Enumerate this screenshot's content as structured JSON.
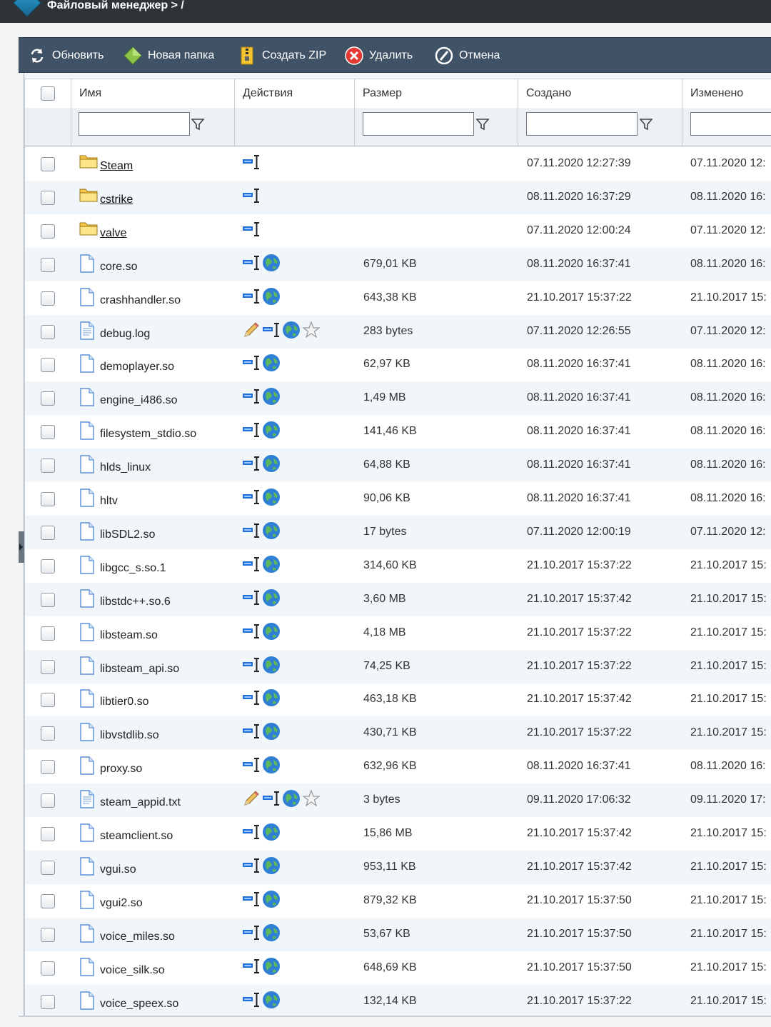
{
  "window": {
    "title": "Файловый менеджер > /"
  },
  "toolbar": {
    "refresh_label": "Обновить",
    "new_folder_label": "Новая папка",
    "create_zip_label": "Создать ZIP",
    "delete_label": "Удалить",
    "cancel_label": "Отмена"
  },
  "columns": {
    "name": "Имя",
    "actions": "Действия",
    "size": "Размер",
    "created": "Создано",
    "modified": "Изменено"
  },
  "filters": {
    "name": "",
    "size": "",
    "created": "",
    "modified": ""
  },
  "colors": {
    "toolbar": "#3f5266",
    "titlebar": "#2e3338",
    "row_alt": "#f1f6fb"
  },
  "files": [
    {
      "name": "Steam",
      "type": "folder",
      "actions": [
        "rename-icon"
      ],
      "size": "",
      "created": "07.11.2020 12:27:39",
      "modified": "07.11.2020 12:"
    },
    {
      "name": "cstrike",
      "type": "folder",
      "actions": [
        "rename-icon"
      ],
      "size": "",
      "created": "08.11.2020 16:37:29",
      "modified": "08.11.2020 16:"
    },
    {
      "name": "valve",
      "type": "folder",
      "actions": [
        "rename-icon"
      ],
      "size": "",
      "created": "07.11.2020 12:00:24",
      "modified": "07.11.2020 12:"
    },
    {
      "name": "core.so",
      "type": "file",
      "actions": [
        "rename-icon",
        "web-icon"
      ],
      "size": "679,01 KB",
      "created": "08.11.2020 16:37:41",
      "modified": "08.11.2020 16:"
    },
    {
      "name": "crashhandler.so",
      "type": "file",
      "actions": [
        "rename-icon",
        "web-icon"
      ],
      "size": "643,38 KB",
      "created": "21.10.2017 15:37:22",
      "modified": "21.10.2017 15:"
    },
    {
      "name": "debug.log",
      "type": "text",
      "actions": [
        "edit-icon",
        "rename-icon",
        "web-icon",
        "star-icon"
      ],
      "size": "283 bytes",
      "created": "07.11.2020 12:26:55",
      "modified": "07.11.2020 12:"
    },
    {
      "name": "demoplayer.so",
      "type": "file",
      "actions": [
        "rename-icon",
        "web-icon"
      ],
      "size": "62,97 KB",
      "created": "08.11.2020 16:37:41",
      "modified": "08.11.2020 16:"
    },
    {
      "name": "engine_i486.so",
      "type": "file",
      "actions": [
        "rename-icon",
        "web-icon"
      ],
      "size": "1,49 MB",
      "created": "08.11.2020 16:37:41",
      "modified": "08.11.2020 16:"
    },
    {
      "name": "filesystem_stdio.so",
      "type": "file",
      "actions": [
        "rename-icon",
        "web-icon"
      ],
      "size": "141,46 KB",
      "created": "08.11.2020 16:37:41",
      "modified": "08.11.2020 16:"
    },
    {
      "name": "hlds_linux",
      "type": "file",
      "actions": [
        "rename-icon",
        "web-icon"
      ],
      "size": "64,88 KB",
      "created": "08.11.2020 16:37:41",
      "modified": "08.11.2020 16:"
    },
    {
      "name": "hltv",
      "type": "file",
      "actions": [
        "rename-icon",
        "web-icon"
      ],
      "size": "90,06 KB",
      "created": "08.11.2020 16:37:41",
      "modified": "08.11.2020 16:"
    },
    {
      "name": "libSDL2.so",
      "type": "file",
      "actions": [
        "rename-icon",
        "web-icon"
      ],
      "size": "17 bytes",
      "created": "07.11.2020 12:00:19",
      "modified": "07.11.2020 12:"
    },
    {
      "name": "libgcc_s.so.1",
      "type": "file",
      "actions": [
        "rename-icon",
        "web-icon"
      ],
      "size": "314,60 KB",
      "created": "21.10.2017 15:37:22",
      "modified": "21.10.2017 15:"
    },
    {
      "name": "libstdc++.so.6",
      "type": "file",
      "actions": [
        "rename-icon",
        "web-icon"
      ],
      "size": "3,60 MB",
      "created": "21.10.2017 15:37:42",
      "modified": "21.10.2017 15:"
    },
    {
      "name": "libsteam.so",
      "type": "file",
      "actions": [
        "rename-icon",
        "web-icon"
      ],
      "size": "4,18 MB",
      "created": "21.10.2017 15:37:22",
      "modified": "21.10.2017 15:"
    },
    {
      "name": "libsteam_api.so",
      "type": "file",
      "actions": [
        "rename-icon",
        "web-icon"
      ],
      "size": "74,25 KB",
      "created": "21.10.2017 15:37:22",
      "modified": "21.10.2017 15:"
    },
    {
      "name": "libtier0.so",
      "type": "file",
      "actions": [
        "rename-icon",
        "web-icon"
      ],
      "size": "463,18 KB",
      "created": "21.10.2017 15:37:42",
      "modified": "21.10.2017 15:"
    },
    {
      "name": "libvstdlib.so",
      "type": "file",
      "actions": [
        "rename-icon",
        "web-icon"
      ],
      "size": "430,71 KB",
      "created": "21.10.2017 15:37:22",
      "modified": "21.10.2017 15:"
    },
    {
      "name": "proxy.so",
      "type": "file",
      "actions": [
        "rename-icon",
        "web-icon"
      ],
      "size": "632,96 KB",
      "created": "08.11.2020 16:37:41",
      "modified": "08.11.2020 16:"
    },
    {
      "name": "steam_appid.txt",
      "type": "text",
      "actions": [
        "edit-icon",
        "rename-icon",
        "web-icon",
        "star-icon"
      ],
      "size": "3 bytes",
      "created": "09.11.2020 17:06:32",
      "modified": "09.11.2020 17:"
    },
    {
      "name": "steamclient.so",
      "type": "file",
      "actions": [
        "rename-icon",
        "web-icon"
      ],
      "size": "15,86 MB",
      "created": "21.10.2017 15:37:42",
      "modified": "21.10.2017 15:"
    },
    {
      "name": "vgui.so",
      "type": "file",
      "actions": [
        "rename-icon",
        "web-icon"
      ],
      "size": "953,11 KB",
      "created": "21.10.2017 15:37:42",
      "modified": "21.10.2017 15:"
    },
    {
      "name": "vgui2.so",
      "type": "file",
      "actions": [
        "rename-icon",
        "web-icon"
      ],
      "size": "879,32 KB",
      "created": "21.10.2017 15:37:50",
      "modified": "21.10.2017 15:"
    },
    {
      "name": "voice_miles.so",
      "type": "file",
      "actions": [
        "rename-icon",
        "web-icon"
      ],
      "size": "53,67 KB",
      "created": "21.10.2017 15:37:50",
      "modified": "21.10.2017 15:"
    },
    {
      "name": "voice_silk.so",
      "type": "file",
      "actions": [
        "rename-icon",
        "web-icon"
      ],
      "size": "648,69 KB",
      "created": "21.10.2017 15:37:50",
      "modified": "21.10.2017 15:"
    },
    {
      "name": "voice_speex.so",
      "type": "file",
      "actions": [
        "rename-icon",
        "web-icon"
      ],
      "size": "132,14 KB",
      "created": "21.10.2017 15:37:22",
      "modified": "21.10.2017 15:"
    }
  ]
}
